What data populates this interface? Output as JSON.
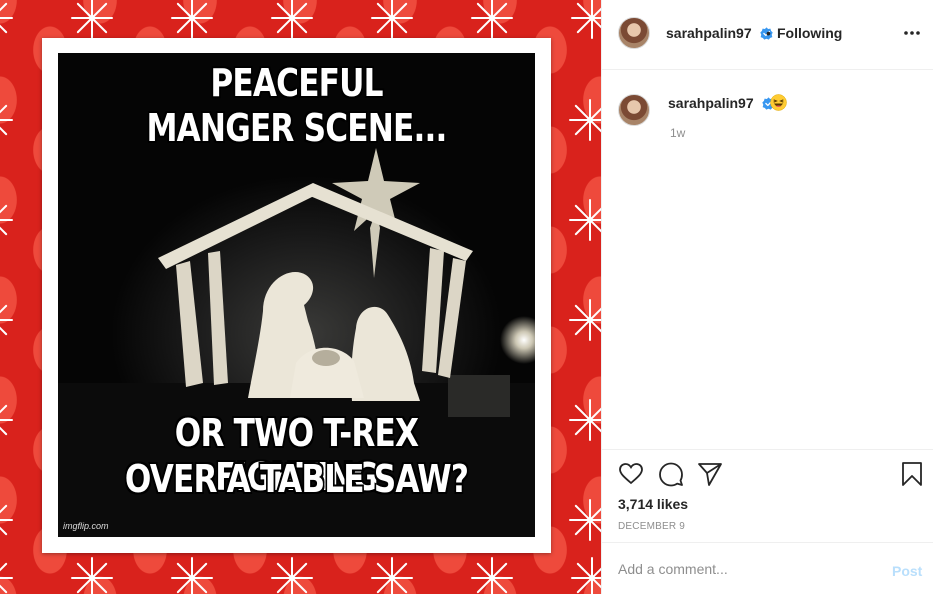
{
  "post": {
    "media": {
      "top_line_1": "PEACEFUL",
      "top_line_2": "MANGER SCENE...",
      "bottom_line_1": "OR TWO T-REX FIGHTING",
      "bottom_line_2": "OVER A TABLE SAW?",
      "watermark": "imgflip.com"
    },
    "header": {
      "username": "sarahpalin97",
      "separator": "•",
      "follow_status": "Following",
      "verified_icon": "verified-badge-icon",
      "more_icon": "more-options-icon"
    },
    "caption": {
      "username": "sarahpalin97",
      "emoji_icon": "laughing-face-emoji",
      "time": "1w"
    },
    "actions": {
      "like_icon": "heart-icon",
      "comment_icon": "speech-bubble-icon",
      "share_icon": "paper-plane-icon",
      "save_icon": "bookmark-icon"
    },
    "likes": "3,714 likes",
    "date": "DECEMBER 9",
    "comment_box": {
      "placeholder": "Add a comment...",
      "post_label": "Post"
    }
  },
  "colors": {
    "verified": "#3897f0",
    "post_button_disabled": "#b9dffc",
    "background_red": "#d9221c"
  }
}
